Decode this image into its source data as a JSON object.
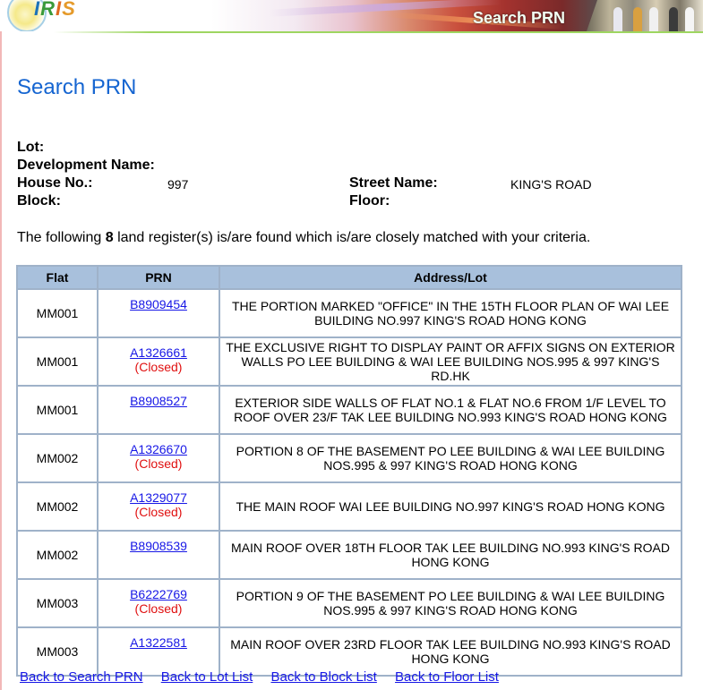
{
  "header": {
    "logo_text": [
      "I",
      "R",
      "I",
      "S"
    ],
    "banner_title": "Search PRN"
  },
  "page_title": "Search PRN",
  "criteria": {
    "lot_label": "Lot:",
    "lot_value": "",
    "development_label": "Development Name:",
    "development_value": "",
    "house_label": "House No.:",
    "house_value": "997",
    "street_label": "Street Name:",
    "street_value": "KING'S ROAD",
    "block_label": "Block:",
    "block_value": "",
    "floor_label": "Floor:",
    "floor_value": ""
  },
  "summary": {
    "prefix": "The following ",
    "count": "8",
    "suffix": " land register(s) is/are found which is/are closely matched with your criteria."
  },
  "table": {
    "headers": [
      "Flat",
      "PRN",
      "Address/Lot"
    ],
    "closed_label": "(Closed)",
    "rows": [
      {
        "flat": "MM001",
        "prn": "B8909454",
        "closed": false,
        "address": "THE PORTION MARKED \"OFFICE\" IN THE 15TH FLOOR PLAN OF WAI LEE BUILDING NO.997 KING'S ROAD HONG KONG"
      },
      {
        "flat": "MM001",
        "prn": "A1326661",
        "closed": true,
        "address": "THE EXCLUSIVE RIGHT TO DISPLAY PAINT OR AFFIX SIGNS ON EXTERIOR WALLS PO LEE BUILDING & WAI LEE BUILDING NOS.995 & 997 KING'S RD.HK"
      },
      {
        "flat": "MM001",
        "prn": "B8908527",
        "closed": false,
        "address": "EXTERIOR SIDE WALLS OF FLAT NO.1 & FLAT NO.6 FROM 1/F LEVEL TO ROOF OVER 23/F TAK LEE BUILDING NO.993 KING'S ROAD HONG KONG"
      },
      {
        "flat": "MM002",
        "prn": "A1326670",
        "closed": true,
        "address": "PORTION 8 OF THE BASEMENT PO LEE BUILDING & WAI LEE BUILDING NOS.995 & 997 KING'S ROAD HONG KONG"
      },
      {
        "flat": "MM002",
        "prn": "A1329077",
        "closed": true,
        "address": "THE MAIN ROOF WAI LEE BUILDING NO.997 KING'S ROAD HONG KONG"
      },
      {
        "flat": "MM002",
        "prn": "B8908539",
        "closed": false,
        "address": "MAIN ROOF OVER 18TH FLOOR TAK LEE BUILDING NO.993 KING'S ROAD HONG KONG"
      },
      {
        "flat": "MM003",
        "prn": "B6222769",
        "closed": true,
        "address": "PORTION 9 OF THE BASEMENT PO LEE BUILDING & WAI LEE BUILDING NOS.995 & 997 KING'S ROAD HONG KONG"
      },
      {
        "flat": "MM003",
        "prn": "A1322581",
        "closed": false,
        "address": "MAIN ROOF OVER 23RD FLOOR TAK LEE BUILDING NO.993 KING'S ROAD HONG KONG"
      }
    ]
  },
  "footer_links": [
    "Back to Search PRN",
    "Back to Lot List",
    "Back to Block List",
    "Back to Floor List"
  ],
  "colors": {
    "title_blue": "#1565d1",
    "table_header_bg": "#a8c0dc",
    "table_border": "#9fb2c9",
    "link": "#1717e6",
    "closed": "#e01010"
  }
}
